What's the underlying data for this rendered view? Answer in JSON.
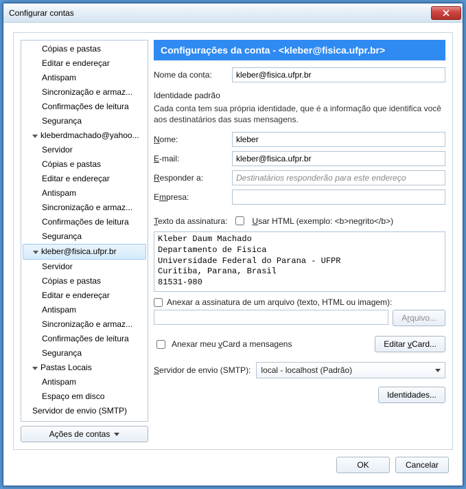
{
  "window": {
    "title": "Configurar contas"
  },
  "tree": {
    "items": [
      {
        "label": "Cópias e pastas",
        "level": 1
      },
      {
        "label": "Editar e endereçar",
        "level": 1
      },
      {
        "label": "Antispam",
        "level": 1
      },
      {
        "label": "Sincronização e armaz...",
        "level": 1
      },
      {
        "label": "Confirmações de leitura",
        "level": 1
      },
      {
        "label": "Segurança",
        "level": 1
      },
      {
        "label": "kleberdmachado@yahoo...",
        "level": 0,
        "expanded": true
      },
      {
        "label": "Servidor",
        "level": 1
      },
      {
        "label": "Cópias e pastas",
        "level": 1
      },
      {
        "label": "Editar e endereçar",
        "level": 1
      },
      {
        "label": "Antispam",
        "level": 1
      },
      {
        "label": "Sincronização e armaz...",
        "level": 1
      },
      {
        "label": "Confirmações de leitura",
        "level": 1
      },
      {
        "label": "Segurança",
        "level": 1
      },
      {
        "label": "kleber@fisica.ufpr.br",
        "level": 0,
        "expanded": true,
        "selected": true
      },
      {
        "label": "Servidor",
        "level": 1
      },
      {
        "label": "Cópias e pastas",
        "level": 1
      },
      {
        "label": "Editar e endereçar",
        "level": 1
      },
      {
        "label": "Antispam",
        "level": 1
      },
      {
        "label": "Sincronização e armaz...",
        "level": 1
      },
      {
        "label": "Confirmações de leitura",
        "level": 1
      },
      {
        "label": "Segurança",
        "level": 1
      },
      {
        "label": "Pastas Locais",
        "level": 0,
        "expanded": true
      },
      {
        "label": "Antispam",
        "level": 1
      },
      {
        "label": "Espaço em disco",
        "level": 1
      },
      {
        "label": "Servidor de envio (SMTP)",
        "level": 0
      }
    ],
    "actions_label": "Ações de contas"
  },
  "panel": {
    "header": "Configurações da conta - <kleber@fisica.ufpr.br>",
    "account_name_label": "Nome da conta:",
    "account_name_value": "kleber@fisica.ufpr.br",
    "identity_title": "Identidade padrão",
    "identity_desc": "Cada conta tem sua própria identidade, que é a informação que identifica você aos destinatários das suas mensagens.",
    "name_label": "Nome:",
    "name_value": "kleber",
    "email_label": "E-mail:",
    "email_value": "kleber@fisica.ufpr.br",
    "reply_label": "Responder a:",
    "reply_placeholder": "Destinatários responderão para este endereço",
    "org_label": "Empresa:",
    "org_value": "",
    "sig_label": "Texto da assinatura:",
    "sig_html_label": "Usar HTML (exemplo: <b>negrito</b>)",
    "sig_text": "Kleber Daum Machado\nDepartamento de Fisica\nUniversidade Federal do Parana - UFPR\nCuritiba, Parana, Brasil\n81531-980",
    "attach_sig_file_label": "Anexar a assinatura de um arquivo (texto, HTML ou imagem):",
    "file_button": "Arquivo...",
    "attach_vcard_label": "Anexar meu vCard a mensagens",
    "edit_vcard_button": "Editar vCard...",
    "smtp_label": "Servidor de envio (SMTP):",
    "smtp_value": "local - localhost (Padrão)",
    "identities_button": "Identidades..."
  },
  "footer": {
    "ok": "OK",
    "cancel": "Cancelar"
  }
}
